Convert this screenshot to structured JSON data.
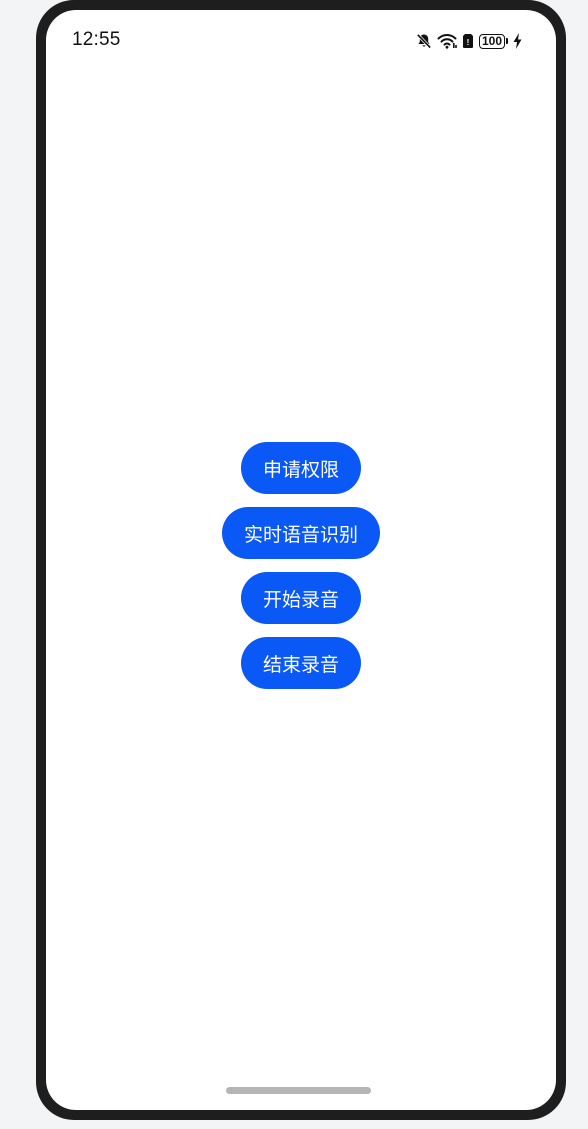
{
  "status_bar": {
    "time": "12:55",
    "battery_level": "100",
    "icons": [
      "bell-off-icon",
      "wifi-icon",
      "sim-card-icon",
      "battery-icon",
      "charging-bolt-icon"
    ]
  },
  "buttons": {
    "request_permission": "申请权限",
    "realtime_speech_recognition": "实时语音识别",
    "start_recording": "开始录音",
    "stop_recording": "结束录音"
  },
  "colors": {
    "button_background": "#0a59f7",
    "button_text": "#ffffff",
    "screen_background": "#ffffff",
    "device_frame": "#1e1e1e"
  }
}
